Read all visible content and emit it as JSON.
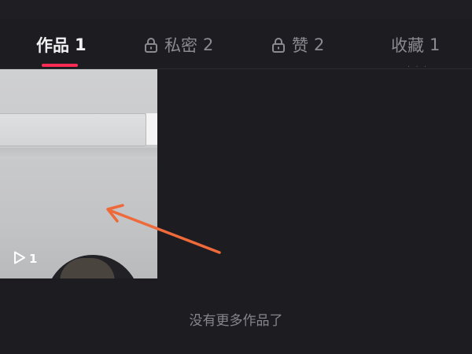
{
  "tabs": [
    {
      "label": "作品",
      "count": "1",
      "locked": false,
      "active": true
    },
    {
      "label": "私密",
      "count": "2",
      "locked": true,
      "active": false
    },
    {
      "label": "赞",
      "count": "2",
      "locked": true,
      "active": false
    },
    {
      "label": "收藏",
      "count": "1",
      "locked": false,
      "active": false
    }
  ],
  "video_grid": [
    {
      "play_count": "1"
    }
  ],
  "empty_message": "没有更多作品了",
  "colors": {
    "background": "#1c1c21",
    "active_tab_indicator": "#fe2c55",
    "annotation_arrow": "#ef6a3a"
  },
  "icons": {
    "lock": "lock-icon",
    "play": "play-icon"
  }
}
